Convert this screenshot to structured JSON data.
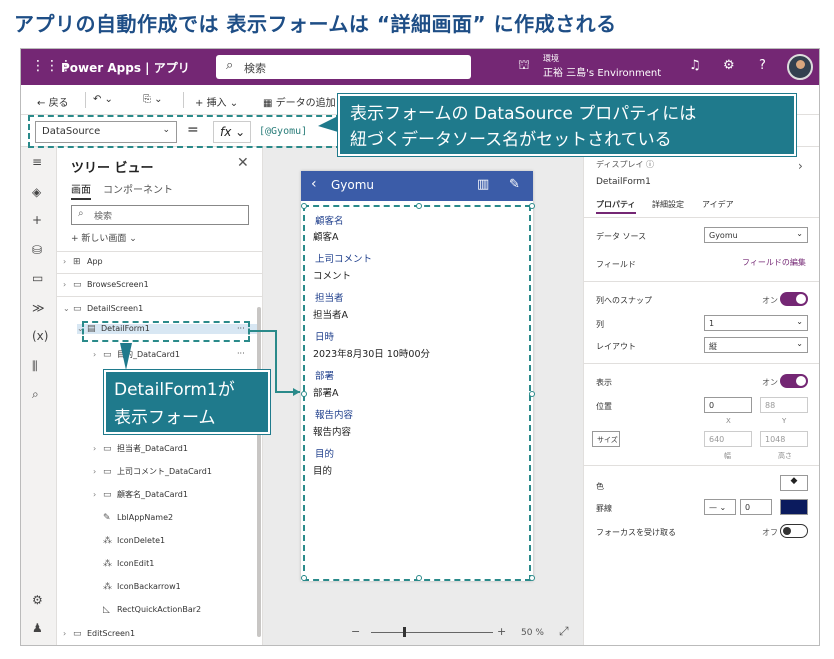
{
  "slide_title": "アプリの自動作成では 表示フォームは “詳細画面” に作成される",
  "app": {
    "brand": "Power Apps | アプリ",
    "search_placeholder": "検索",
    "env_label": "環境",
    "env_name": "正裕 三島's Environment"
  },
  "cmd": {
    "back": "戻る",
    "insert": "挿入",
    "add_data": "データの追加"
  },
  "fxbar": {
    "property": "DataSource",
    "equals": "=",
    "fx": "fx",
    "formula": "[@Gyomu]"
  },
  "tree": {
    "title": "ツリー ビュー",
    "tab_screens": "画面",
    "tab_components": "コンポーネント",
    "search_placeholder": "検索",
    "new_screen": "新しい画面",
    "nodes": [
      "App",
      "BrowseScreen1",
      "DetailScreen1",
      "DetailForm1",
      "目的_DataCard1",
      "担当者_DataCard1",
      "上司コメント_DataCard1",
      "顧客名_DataCard1",
      "LblAppName2",
      "IconDelete1",
      "IconEdit1",
      "IconBackarrow1",
      "RectQuickActionBar2",
      "EditScreen1"
    ]
  },
  "screen": {
    "title": "Gyomu",
    "fields": [
      {
        "label": "顧客名",
        "value": "顧客A"
      },
      {
        "label": "上司コメント",
        "value": "コメント"
      },
      {
        "label": "担当者",
        "value": "担当者A"
      },
      {
        "label": "日時",
        "value": "2023年8月30日 10時00分"
      },
      {
        "label": "部署",
        "value": "部署A"
      },
      {
        "label": "報告内容",
        "value": "報告内容"
      },
      {
        "label": "目的",
        "value": "目的"
      }
    ]
  },
  "zoom": {
    "minus": "−",
    "plus": "+",
    "percent": "50 %"
  },
  "props": {
    "kind": "ディスプレイ",
    "name": "DetailForm1",
    "tab_props": "プロパティ",
    "tab_advanced": "詳細設定",
    "tab_ideas": "アイデア",
    "data_source_label": "データ ソース",
    "data_source": "Gyomu",
    "fields_label": "フィールド",
    "fields_edit": "フィールドの編集",
    "snap_label": "列へのスナップ",
    "snap_state": "オン",
    "columns_label": "列",
    "columns": "1",
    "layout_label": "レイアウト",
    "layout": "縦",
    "visible_label": "表示",
    "visible_state": "オン",
    "position_label": "位置",
    "x": "0",
    "y": "88",
    "x_sub": "X",
    "y_sub": "Y",
    "size_label": "サイズ",
    "width": "640",
    "height": "1048",
    "w_sub": "幅",
    "h_sub": "高さ",
    "color_label": "色",
    "border_label": "罫線",
    "border_width": "0",
    "focus_label": "フォーカスを受け取る",
    "focus_state": "オフ"
  },
  "callouts": {
    "top_line1": "表示フォームの DataSource プロパティには",
    "top_line2": "紐づくデータソース名がセットされている",
    "left_line1": "DetailForm1が",
    "left_line2": "表示フォーム"
  },
  "colors": {
    "title": "#1e4e86",
    "topbar": "#742774",
    "callout": "#1f7a8c",
    "screen_header": "#3b5ca8"
  }
}
